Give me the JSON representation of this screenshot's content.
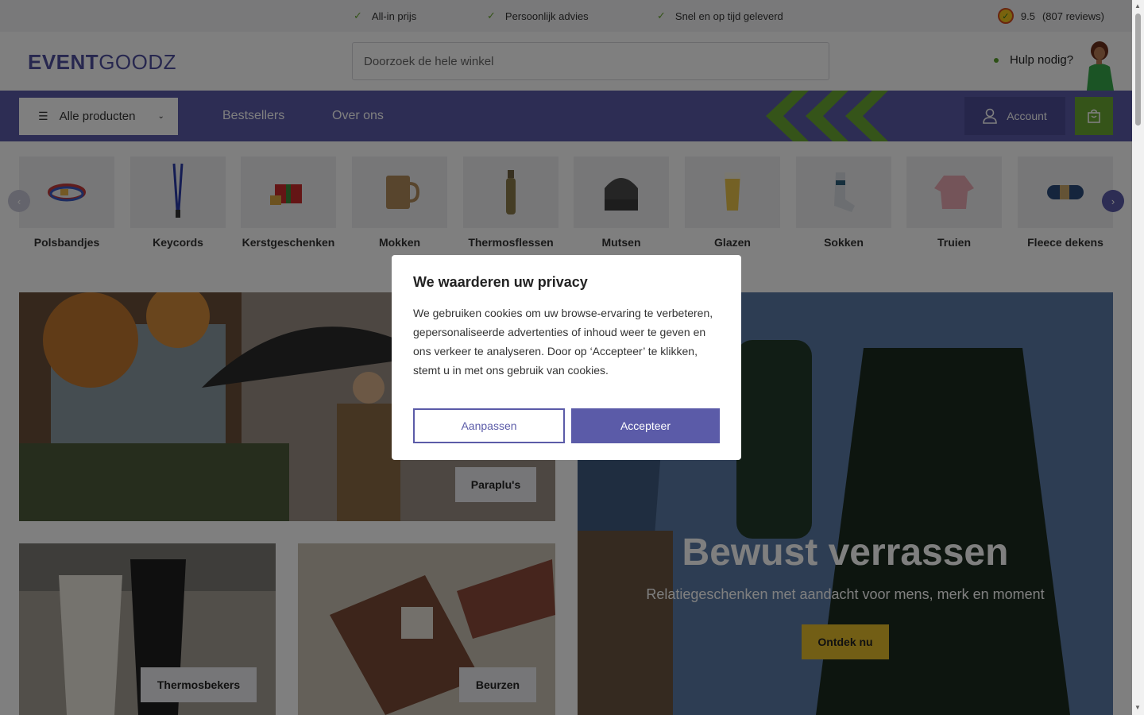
{
  "topbar": {
    "usps": [
      "All-in prijs",
      "Persoonlijk advies",
      "Snel en op tijd geleverd"
    ],
    "rating_score": "9.5",
    "rating_reviews": "(807 reviews)"
  },
  "header": {
    "logo_bold": "EVENT",
    "logo_light": "GOODZ",
    "search_placeholder": "Doorzoek de hele winkel",
    "help_label": "Hulp nodig?"
  },
  "nav": {
    "all_products": "Alle producten",
    "links": [
      "Bestsellers",
      "Over ons"
    ],
    "account": "Account"
  },
  "categories": [
    "Polsbandjes",
    "Keycords",
    "Kerstgeschenken",
    "Mokken",
    "Thermosflessen",
    "Mutsen",
    "Glazen",
    "Sokken",
    "Truien",
    "Fleece dekens"
  ],
  "hero": {
    "umbrella_btn": "Paraplu's",
    "cups_btn": "Thermosbekers",
    "wallets_btn": "Beurzen",
    "title": "Bewust verrassen",
    "subtitle": "Relatiegeschenken met aandacht voor mens, merk en moment",
    "cta": "Ontdek nu"
  },
  "cookie_modal": {
    "title": "We waarderen uw privacy",
    "body": "We gebruiken cookies om uw browse-ervaring te verbeteren, gepersonaliseerde advertenties of inhoud weer te geven en ons verkeer te analyseren. Door op ‘Accepteer’ te klikken, stemt u in met ons gebruik van cookies.",
    "customize": "Aanpassen",
    "accept": "Accepteer"
  },
  "colors": {
    "brand_purple": "#5b5ba8",
    "brand_green": "#6aa832",
    "cta_yellow": "#e4bd2a"
  }
}
